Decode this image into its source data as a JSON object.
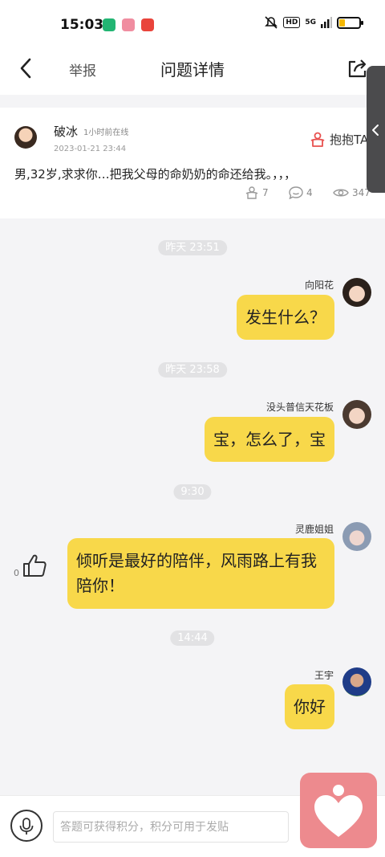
{
  "status_bar": {
    "time": "15:03",
    "app_icons": [
      "wechat-icon",
      "heart-app-icon",
      "red-app-icon"
    ],
    "app_icon_colors": [
      "#22b573",
      "#f08da0",
      "#e9443b"
    ],
    "hd_label": "HD",
    "network_label": "5G",
    "battery_level_percent": 25,
    "accent": "#f5b800"
  },
  "nav": {
    "report_label": "举报",
    "title": "问题详情"
  },
  "question": {
    "asker_name": "破冰",
    "online_status": "1小时前在线",
    "date": "2023-01-21 23:44",
    "hug_label": "抱抱TA",
    "text": "男,32岁,求求你…把我父母的命奶奶的命还给我。，，，",
    "hug_count": "7",
    "comment_count": "4",
    "view_count": "347"
  },
  "messages": [
    {
      "time": "昨天 23:51",
      "sender": "向阳花",
      "text": "发生什么？"
    },
    {
      "time": "昨天 23:58",
      "sender": "没头普信天花板",
      "text": "宝，怎么了，宝"
    },
    {
      "time": "9:30",
      "sender": "灵鹿姐姐",
      "text": "倾听是最好的陪伴，风雨路上有我陪你！",
      "like_count": "0"
    },
    {
      "time": "14:44",
      "sender": "王宇",
      "text": "你好"
    }
  ],
  "input": {
    "placeholder": "答题可获得积分，积分可用于发贴"
  },
  "colors": {
    "bubble": "#f8d84a",
    "fab": "#ed8a8e",
    "hug_icon": "#e8514f"
  }
}
